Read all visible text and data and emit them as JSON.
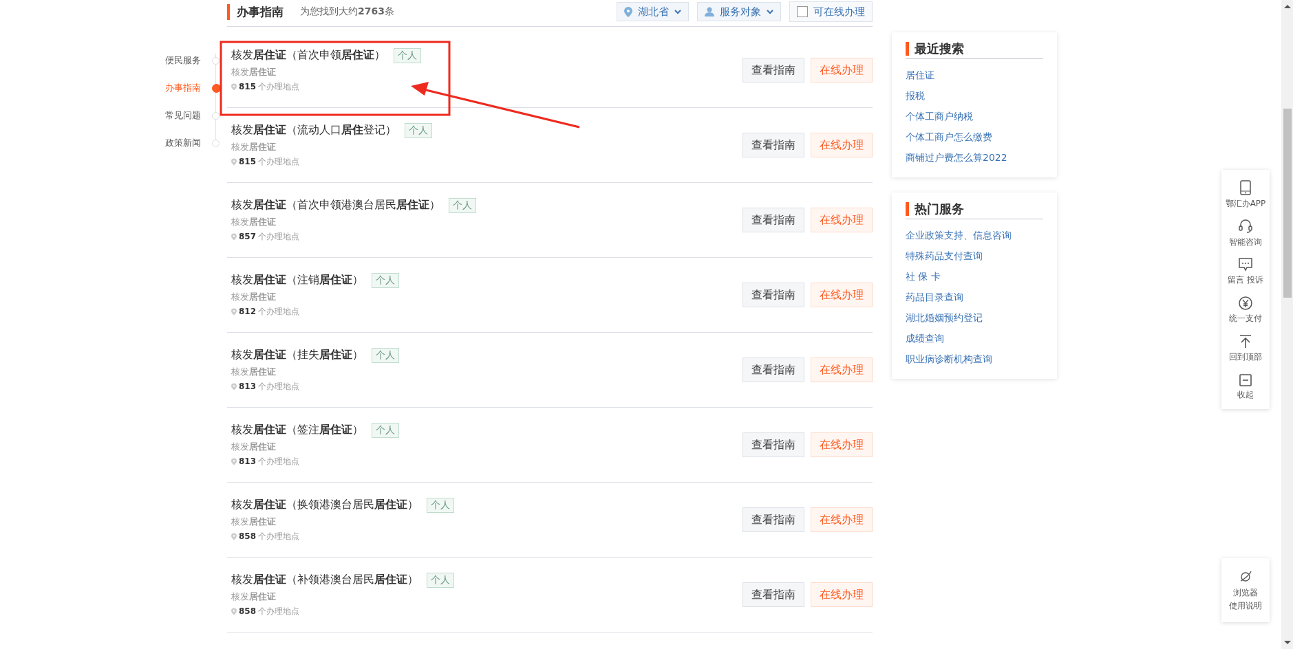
{
  "header": {
    "title": "办事指南",
    "result_count": "为您找到大约**2763**条",
    "filters": [
      {
        "kind": "location",
        "label": "湖北省"
      },
      {
        "kind": "audience",
        "label": "服务对象"
      }
    ],
    "online_only": {
      "label": "可在线办理",
      "checked": false
    }
  },
  "side_nav": [
    {
      "label": "便民服务",
      "selected": false
    },
    {
      "label": "办事指南",
      "selected": true
    },
    {
      "label": "常见问题",
      "selected": false
    },
    {
      "label": "政策新闻",
      "selected": false
    }
  ],
  "results": [
    {
      "title": "核发**居住证**（首次申领**居住证**）",
      "tag": "个人",
      "subtitle": "核发**居住证**",
      "locations": "815",
      "locations_suffix": "个办理地点",
      "guide_button": "查看指南",
      "online_button": "在线办理"
    },
    {
      "title": "核发**居住证**（流动人口**居住**登记）",
      "tag": "个人",
      "subtitle": "核发**居住证**",
      "locations": "815",
      "locations_suffix": "个办理地点",
      "guide_button": "查看指南",
      "online_button": "在线办理"
    },
    {
      "title": "核发**居住证**（首次申领港澳台居民**居住证**）",
      "tag": "个人",
      "subtitle": "核发**居住证**",
      "locations": "857",
      "locations_suffix": "个办理地点",
      "guide_button": "查看指南",
      "online_button": "在线办理"
    },
    {
      "title": "核发**居住证**（注销**居住证**）",
      "tag": "个人",
      "subtitle": "核发**居住证**",
      "locations": "812",
      "locations_suffix": "个办理地点",
      "guide_button": "查看指南",
      "online_button": "在线办理"
    },
    {
      "title": "核发**居住证**（挂失**居住证**）",
      "tag": "个人",
      "subtitle": "核发**居住证**",
      "locations": "813",
      "locations_suffix": "个办理地点",
      "guide_button": "查看指南",
      "online_button": "在线办理"
    },
    {
      "title": "核发**居住证**（签注**居住证**）",
      "tag": "个人",
      "subtitle": "核发**居住证**",
      "locations": "813",
      "locations_suffix": "个办理地点",
      "guide_button": "查看指南",
      "online_button": "在线办理"
    },
    {
      "title": "核发**居住证**（换领港澳台居民**居住证**）",
      "tag": "个人",
      "subtitle": "核发**居住证**",
      "locations": "858",
      "locations_suffix": "个办理地点",
      "guide_button": "查看指南",
      "online_button": "在线办理"
    },
    {
      "title": "核发**居住证**（补领港澳台居民**居住证**）",
      "tag": "个人",
      "subtitle": "核发**居住证**",
      "locations": "858",
      "locations_suffix": "个办理地点",
      "guide_button": "查看指南",
      "online_button": "在线办理"
    }
  ],
  "recent_searches": {
    "title": "最近搜索",
    "items": [
      "居住证",
      "报税",
      "个体工商户纳税",
      "个体工商户怎么缴费",
      "商铺过户费怎么算2022"
    ]
  },
  "hot_services": {
    "title": "热门服务",
    "items": [
      "企业政策支持、信息咨询",
      "特殊药品支付查询",
      "社 保 卡",
      "药品目录查询",
      "湖北婚姻预约登记",
      "成绩查询",
      "职业病诊断机构查询"
    ]
  },
  "float_toolbar": [
    {
      "kind": "phone",
      "label": "鄂汇办APP"
    },
    {
      "kind": "headset",
      "label": "智能咨询"
    },
    {
      "kind": "message",
      "label": "留言 投诉"
    },
    {
      "kind": "yen",
      "label": "统一支付"
    },
    {
      "kind": "top",
      "label": "回到顶部"
    },
    {
      "kind": "collapse",
      "label": "收起"
    }
  ],
  "browser_help": {
    "lines": [
      "浏览器",
      "使用说明"
    ]
  }
}
